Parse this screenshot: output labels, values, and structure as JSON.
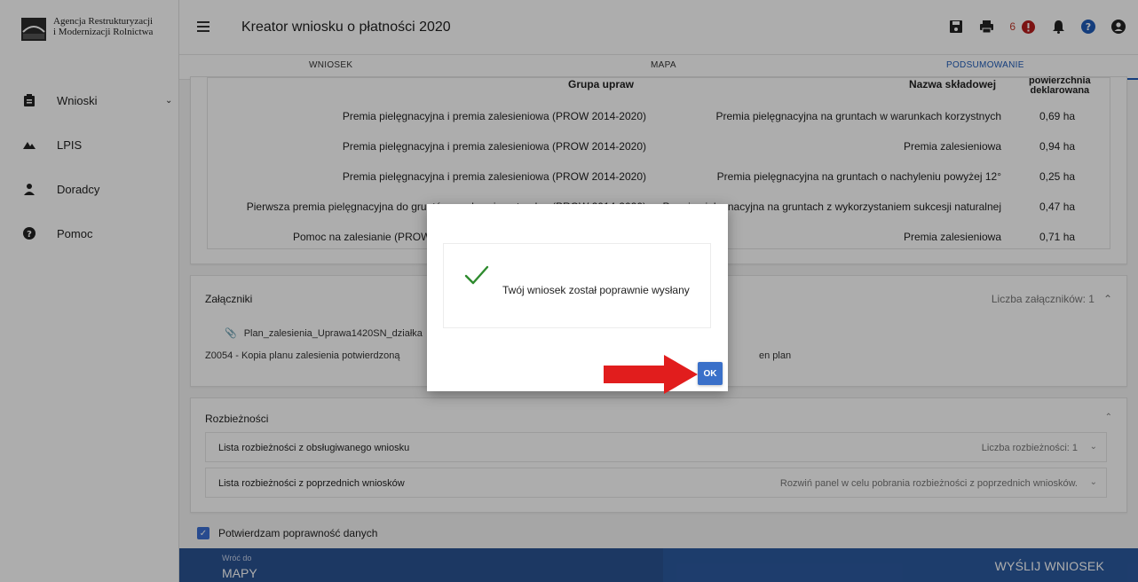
{
  "logo": {
    "line1": "Agencja Restrukturyzacji",
    "line2": "i Modernizacji Rolnictwa"
  },
  "sidebar": {
    "items": [
      {
        "label": "Wnioski",
        "icon": "clipboard-icon"
      },
      {
        "label": "LPIS",
        "icon": "mountain-icon"
      },
      {
        "label": "Doradcy",
        "icon": "person-icon"
      },
      {
        "label": "Pomoc",
        "icon": "help-icon"
      }
    ]
  },
  "header": {
    "title": "Kreator wniosku o płatności 2020",
    "error_count": "6"
  },
  "tabs": [
    {
      "label": "WNIOSEK"
    },
    {
      "label": "MAPA"
    },
    {
      "label": "PODSUMOWANIE"
    }
  ],
  "table": {
    "col1": "Grupa upraw",
    "col2": "Nazwa składowej",
    "col3a": "powierzchnia",
    "col3b": "deklarowana",
    "rows": [
      {
        "grupa": "Premia pielęgnacyjna i premia zalesieniowa (PROW 2014-2020)",
        "nazwa": "Premia pielęgnacyjna na gruntach w warunkach korzystnych",
        "pow": "0,69 ha"
      },
      {
        "grupa": "Premia pielęgnacyjna i premia zalesieniowa (PROW 2014-2020)",
        "nazwa": "Premia zalesieniowa",
        "pow": "0,94 ha"
      },
      {
        "grupa": "Premia pielęgnacyjna i premia zalesieniowa (PROW 2014-2020)",
        "nazwa": "Premia pielęgnacyjna na gruntach o nachyleniu powyżej 12°",
        "pow": "0,25 ha"
      },
      {
        "grupa": "Pierwsza premia pielęgnacyjna do gruntów z sukcesja naturalna (PROW 2014-2020)",
        "nazwa": "Premia pielegnacyjna na gruntach z wykorzystaniem sukcesji naturalnej",
        "pow": "0,47 ha"
      },
      {
        "grupa": "Pomoc na zalesianie (PROW 2",
        "nazwa": "Premia zalesieniowa",
        "pow": "0,71 ha"
      }
    ]
  },
  "attachments": {
    "title": "Załączniki",
    "count": "Liczba załączników: 1",
    "file": "Plan_zalesienia_Uprawa1420SN_działka",
    "desc": "Z0054 - Kopia planu zalesienia potwierdzoną",
    "desc_tail": "en plan"
  },
  "discrepancies": {
    "title": "Rozbieżności",
    "rows": [
      {
        "label": "Lista rozbieżności z obsługiwanego wniosku",
        "info": "Liczba rozbieżności: 1"
      },
      {
        "label": "Lista rozbieżności z poprzednich wniosków",
        "info": "Rozwiń panel w celu pobrania rozbieżności z poprzednich wniosków."
      }
    ]
  },
  "confirm": {
    "label": "Potwierdzam poprawność danych"
  },
  "footer": {
    "back_small": "Wróć do",
    "back_big": "MAPY",
    "send": "WYŚLIJ WNIOSEK"
  },
  "dialog": {
    "message": "Twój wniosek został poprawnie wysłany",
    "ok": "OK"
  },
  "colors": {
    "primary": "#2c5aa0",
    "accent": "#1e5bb7",
    "success": "#2e8b2e",
    "arrow": "#e11d1d"
  }
}
